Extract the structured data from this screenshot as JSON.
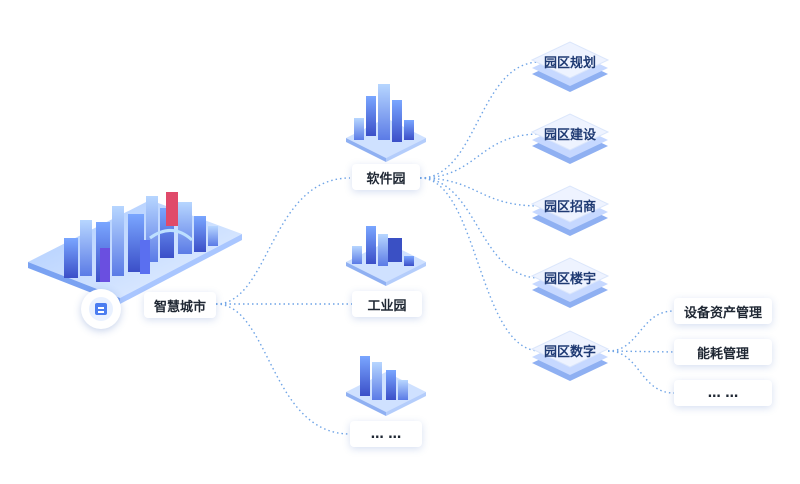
{
  "root": {
    "label": "智慧城市"
  },
  "parks": [
    {
      "label": "软件园"
    },
    {
      "label": "工业园"
    },
    {
      "label": "… …"
    }
  ],
  "functions": [
    {
      "label": "园区规划"
    },
    {
      "label": "园区建设"
    },
    {
      "label": "园区招商"
    },
    {
      "label": "园区楼宇"
    },
    {
      "label": "园区数字"
    }
  ],
  "digital_items": [
    {
      "label": "设备资产管理"
    },
    {
      "label": "能耗管理"
    },
    {
      "label": "… …"
    }
  ],
  "colors": {
    "connector": "#6fa4e6",
    "tile_top": "#eef3ff",
    "tile_layer": "#8fb0f2",
    "building": "#4c6fe0",
    "building_light": "#8fc1ff",
    "ground": "#cfe1ff"
  }
}
